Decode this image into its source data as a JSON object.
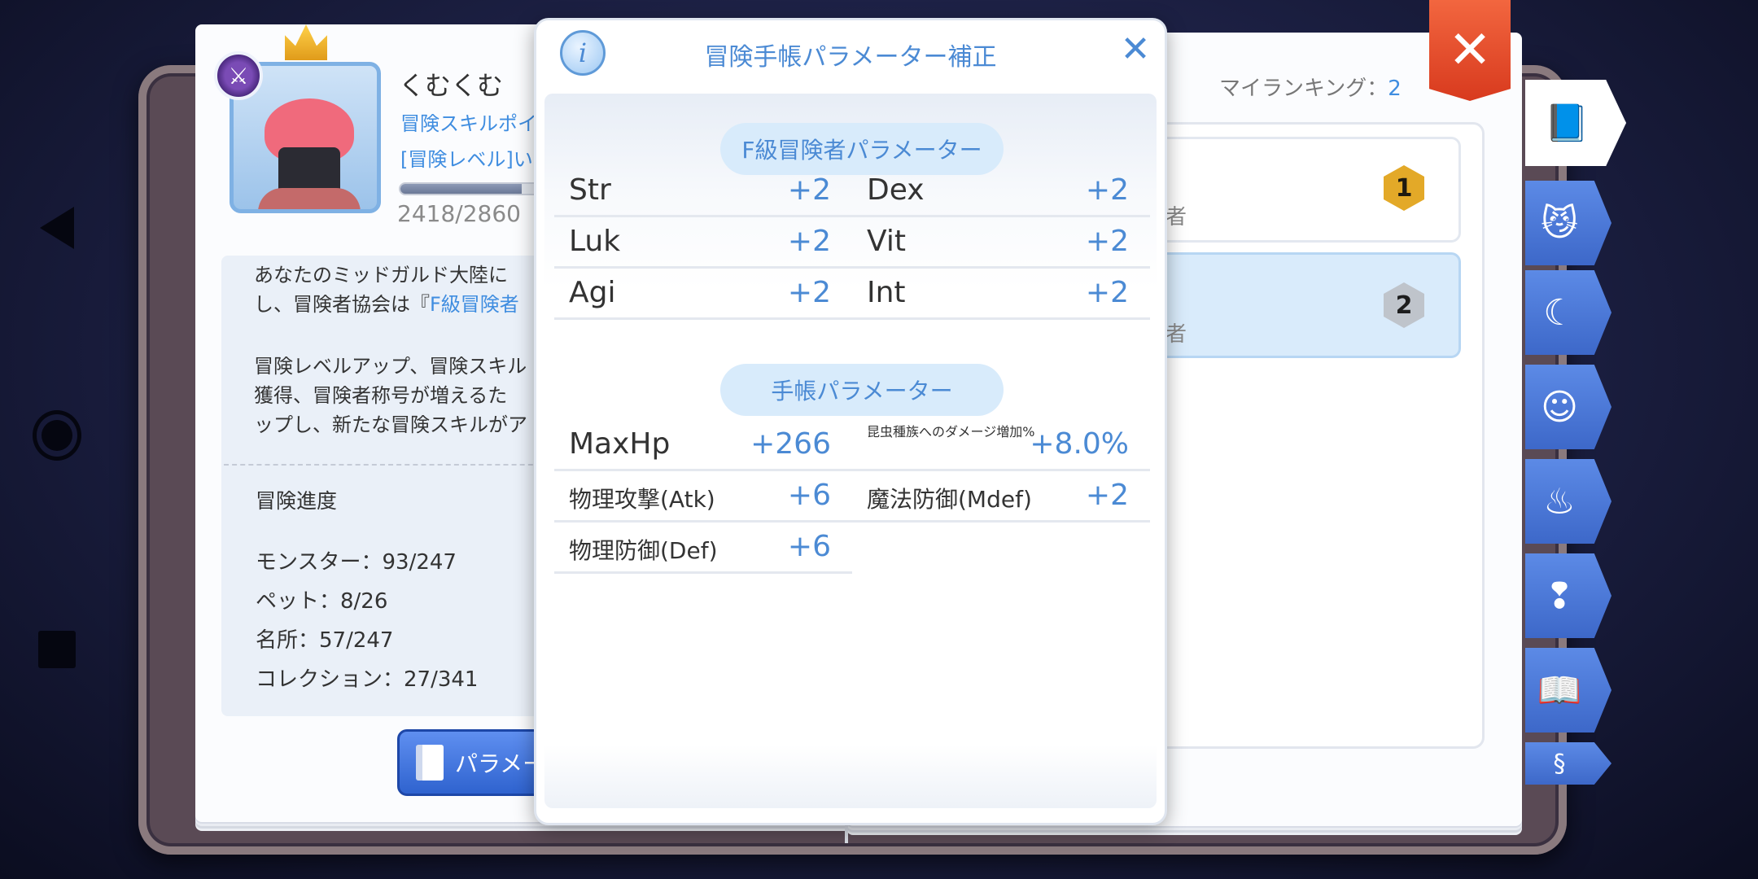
{
  "system_nav": {
    "back": "back",
    "home": "home",
    "recent": "recent"
  },
  "profile": {
    "name": "くむくむ",
    "skill_points_label": "冒険スキルポイ",
    "level_label": "[冒険レベル]い",
    "xp_progress": 0.845,
    "xp_text": "2418/2860"
  },
  "description": {
    "line1": "あなたのミッドガルド大陸に",
    "line2_prefix": "し、冒険者協会は『",
    "line2_highlight": "F級冒険者",
    "line3": "冒険レベルアップ、冒険スキル",
    "line4": "獲得、冒険者称号が増えるた",
    "line5": "ップし、新たな冒険スキルがア"
  },
  "progress": {
    "title": "冒険進度",
    "monster": "モンスター：93/247",
    "pet": "ペット：8/26",
    "place": "名所：57/247",
    "collection": "コレクション：27/341"
  },
  "parameter_button": {
    "label": "パラメー"
  },
  "right_page": {
    "ranking_label": "マイランキング：",
    "ranking_value": "2",
    "rows": [
      {
        "text": "者",
        "medal": "1"
      },
      {
        "text": "者",
        "medal": "2"
      }
    ]
  },
  "tabs": [
    "book-icon",
    "cat-face-icon",
    "horns-icon",
    "blob-face-icon",
    "chef-hat-icon",
    "head-exclaim-icon",
    "open-book-icon",
    "scroll-icon"
  ],
  "dialog": {
    "title": "冒険手帳パラメーター補正",
    "info_glyph": "i",
    "section1_title": "F級冒険者パラメーター",
    "section1_rows": [
      {
        "k1": "Str",
        "v1": "+2",
        "k2": "Dex",
        "v2": "+2"
      },
      {
        "k1": "Luk",
        "v1": "+2",
        "k2": "Vit",
        "v2": "+2"
      },
      {
        "k1": "Agi",
        "v1": "+2",
        "k2": "Int",
        "v2": "+2"
      }
    ],
    "section2_title": "手帳パラメーター",
    "section2_rows": [
      {
        "k1": "MaxHp",
        "v1": "+266",
        "k2": "昆虫種族へのダメージ増加%",
        "v2": "+8.0%"
      },
      {
        "k1": "物理攻撃(Atk)",
        "v1": "+6",
        "k2": "魔法防御(Mdef)",
        "v2": "+2"
      },
      {
        "k1": "物理防御(Def)",
        "v1": "+6"
      }
    ]
  },
  "colors": {
    "accent": "#4b8ad4",
    "close_ribbon": "#e8492a",
    "tab_blue": "#3d68c9"
  }
}
